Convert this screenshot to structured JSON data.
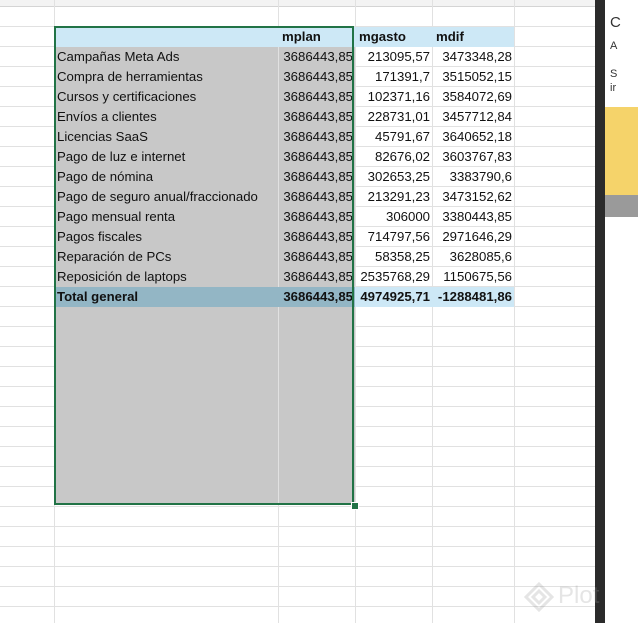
{
  "pivot": {
    "headers": {
      "label": "",
      "mplan": "mplan",
      "mgasto": "mgasto",
      "mdif": "mdif"
    },
    "rows": [
      {
        "label": "Campañas Meta Ads",
        "mplan": "3686443,85",
        "mgasto": "213095,57",
        "mdif": "3473348,28"
      },
      {
        "label": "Compra de herramientas",
        "mplan": "3686443,85",
        "mgasto": "171391,7",
        "mdif": "3515052,15"
      },
      {
        "label": "Cursos y certificaciones",
        "mplan": "3686443,85",
        "mgasto": "102371,16",
        "mdif": "3584072,69"
      },
      {
        "label": "Envíos a clientes",
        "mplan": "3686443,85",
        "mgasto": "228731,01",
        "mdif": "3457712,84"
      },
      {
        "label": "Licencias SaaS",
        "mplan": "3686443,85",
        "mgasto": "45791,67",
        "mdif": "3640652,18"
      },
      {
        "label": "Pago de luz e internet",
        "mplan": "3686443,85",
        "mgasto": "82676,02",
        "mdif": "3603767,83"
      },
      {
        "label": "Pago de nómina",
        "mplan": "3686443,85",
        "mgasto": "302653,25",
        "mdif": "3383790,6"
      },
      {
        "label": "Pago de seguro anual/fraccionado",
        "mplan": "3686443,85",
        "mgasto": "213291,23",
        "mdif": "3473152,62"
      },
      {
        "label": "Pago mensual renta",
        "mplan": "3686443,85",
        "mgasto": "306000",
        "mdif": "3380443,85"
      },
      {
        "label": "Pagos fiscales",
        "mplan": "3686443,85",
        "mgasto": "714797,56",
        "mdif": "2971646,29"
      },
      {
        "label": "Reparación de PCs",
        "mplan": "3686443,85",
        "mgasto": "58358,25",
        "mdif": "3628085,6"
      },
      {
        "label": "Reposición de laptops",
        "mplan": "3686443,85",
        "mgasto": "2535768,29",
        "mdif": "1150675,56"
      }
    ],
    "total": {
      "label": "Total general",
      "mplan": "3686443,85",
      "mgasto": "4974925,71",
      "mdif": "-1288481,86"
    }
  },
  "side_pane": {
    "line1": "C",
    "line2": "A",
    "line3": "S",
    "line4": "ir"
  },
  "watermark": {
    "text": "Plot"
  },
  "colors": {
    "selection": "#217346",
    "header_band": "#cde8f6",
    "total_band": "#93b6c5",
    "selected_fill": "#c8c8c8"
  }
}
